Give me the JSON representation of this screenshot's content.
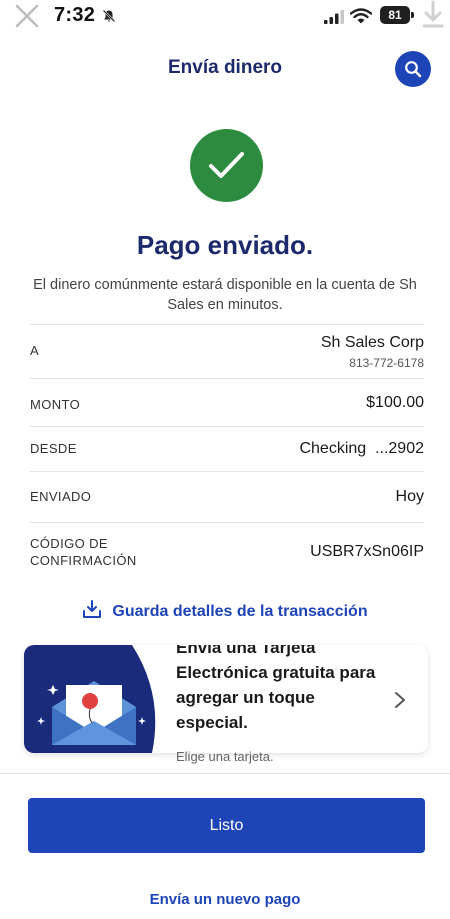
{
  "status_bar": {
    "time": "7:32",
    "battery": "81"
  },
  "header": {
    "title": "Envía dinero",
    "search_icon": "search-icon"
  },
  "confirmation": {
    "icon": "checkmark-icon",
    "title": "Pago enviado.",
    "message": "El dinero comúnmente estará disponible en la cuenta de Sh Sales en minutos."
  },
  "details": {
    "recipient": {
      "label": "A",
      "name": "Sh Sales Corp",
      "phone": "813-772-6178"
    },
    "amount": {
      "label": "MONTO",
      "value": "$100.00"
    },
    "from": {
      "label": "DESDE",
      "value": "Checking  ...2902"
    },
    "sent": {
      "label": "ENVIADO",
      "value": "Hoy"
    },
    "confirmation_code": {
      "label_line1": "CÓDIGO DE",
      "label_line2": "CONFIRMACIÓN",
      "value": "USBR7xSn06IP"
    }
  },
  "save_details": {
    "label": "Guarda detalles de la transacción",
    "icon": "download-icon"
  },
  "promo": {
    "text": "Envía una Tarjeta Electrónica gratuita para agregar un toque especial.",
    "subtext": "Elige una tarjeta.",
    "icon": "chevron-right-icon"
  },
  "actions": {
    "done": "Listo",
    "new_payment": "Envía un nuevo pago"
  },
  "colors": {
    "brand_blue": "#1e45b8",
    "title_navy": "#1c2a6b",
    "success_green": "#2c8b3e"
  }
}
